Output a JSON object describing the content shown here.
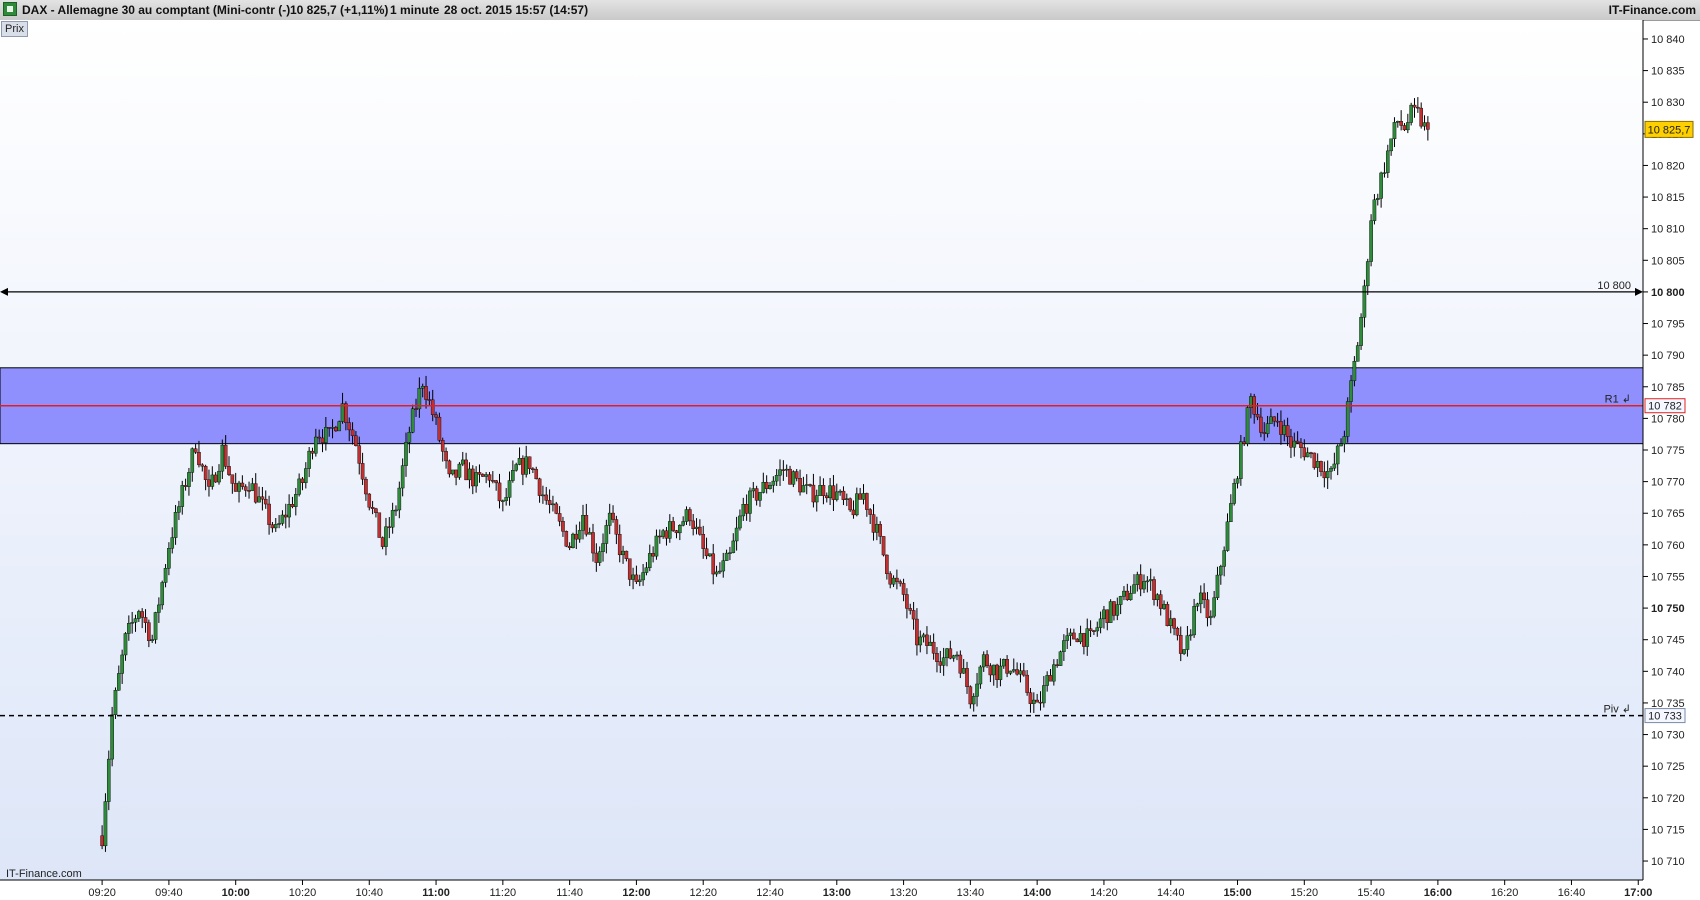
{
  "header": {
    "instrument": "DAX - Allemagne 30 au comptant (Mini-contr (-)",
    "last_change": "10 825,7 (+1,11%)",
    "period": "1 minute",
    "datetime": "28 oct. 2015 15:57 (14:57)",
    "brand": "IT-Finance.com"
  },
  "panel_tab": "Prix",
  "watermark": "IT-Finance.com",
  "chart_data": {
    "type": "line",
    "subtype": "candlestick",
    "ylim": [
      10707,
      10843
    ],
    "y_ticks": [
      {
        "v": 10840,
        "label": "10 840",
        "bold": false
      },
      {
        "v": 10835,
        "label": "10 835",
        "bold": false
      },
      {
        "v": 10830,
        "label": "10 830",
        "bold": false
      },
      {
        "v": 10825,
        "label": "10 825",
        "bold": false
      },
      {
        "v": 10820,
        "label": "10 820",
        "bold": false
      },
      {
        "v": 10815,
        "label": "10 815",
        "bold": false
      },
      {
        "v": 10810,
        "label": "10 810",
        "bold": false
      },
      {
        "v": 10805,
        "label": "10 805",
        "bold": false
      },
      {
        "v": 10800,
        "label": "10 800",
        "bold": true
      },
      {
        "v": 10795,
        "label": "10 795",
        "bold": false
      },
      {
        "v": 10790,
        "label": "10 790",
        "bold": false
      },
      {
        "v": 10785,
        "label": "10 785",
        "bold": false
      },
      {
        "v": 10780,
        "label": "10 780",
        "bold": false
      },
      {
        "v": 10775,
        "label": "10 775",
        "bold": false
      },
      {
        "v": 10770,
        "label": "10 770",
        "bold": false
      },
      {
        "v": 10765,
        "label": "10 765",
        "bold": false
      },
      {
        "v": 10760,
        "label": "10 760",
        "bold": false
      },
      {
        "v": 10755,
        "label": "10 755",
        "bold": false
      },
      {
        "v": 10750,
        "label": "10 750",
        "bold": true
      },
      {
        "v": 10745,
        "label": "10 745",
        "bold": false
      },
      {
        "v": 10740,
        "label": "10 740",
        "bold": false
      },
      {
        "v": 10735,
        "label": "10 735",
        "bold": false
      },
      {
        "v": 10730,
        "label": "10 730",
        "bold": false
      },
      {
        "v": 10725,
        "label": "10 725",
        "bold": false
      },
      {
        "v": 10720,
        "label": "10 720",
        "bold": false
      },
      {
        "v": 10715,
        "label": "10 715",
        "bold": false
      },
      {
        "v": 10710,
        "label": "10 710",
        "bold": false
      }
    ],
    "x_ticks": [
      {
        "t": "09:20",
        "label": "09:20",
        "bold": false
      },
      {
        "t": "09:40",
        "label": "09:40",
        "bold": false
      },
      {
        "t": "10:00",
        "label": "10:00",
        "bold": true
      },
      {
        "t": "10:20",
        "label": "10:20",
        "bold": false
      },
      {
        "t": "10:40",
        "label": "10:40",
        "bold": false
      },
      {
        "t": "11:00",
        "label": "11:00",
        "bold": true
      },
      {
        "t": "11:20",
        "label": "11:20",
        "bold": false
      },
      {
        "t": "11:40",
        "label": "11:40",
        "bold": false
      },
      {
        "t": "12:00",
        "label": "12:00",
        "bold": true
      },
      {
        "t": "12:20",
        "label": "12:20",
        "bold": false
      },
      {
        "t": "12:40",
        "label": "12:40",
        "bold": false
      },
      {
        "t": "13:00",
        "label": "13:00",
        "bold": true
      },
      {
        "t": "13:20",
        "label": "13:20",
        "bold": false
      },
      {
        "t": "13:40",
        "label": "13:40",
        "bold": false
      },
      {
        "t": "14:00",
        "label": "14:00",
        "bold": true
      },
      {
        "t": "14:20",
        "label": "14:20",
        "bold": false
      },
      {
        "t": "14:40",
        "label": "14:40",
        "bold": false
      },
      {
        "t": "15:00",
        "label": "15:00",
        "bold": true
      },
      {
        "t": "15:20",
        "label": "15:20",
        "bold": false
      },
      {
        "t": "15:40",
        "label": "15:40",
        "bold": false
      },
      {
        "t": "16:00",
        "label": "16:00",
        "bold": true
      },
      {
        "t": "16:20",
        "label": "16:20",
        "bold": false
      },
      {
        "t": "16:40",
        "label": "16:40",
        "bold": false
      },
      {
        "t": "17:00",
        "label": "17:00",
        "bold": true
      }
    ],
    "price_path": [
      {
        "t": "09:20",
        "v": 10714
      },
      {
        "t": "09:23",
        "v": 10733
      },
      {
        "t": "09:27",
        "v": 10745
      },
      {
        "t": "09:31",
        "v": 10750
      },
      {
        "t": "09:35",
        "v": 10745
      },
      {
        "t": "09:40",
        "v": 10760
      },
      {
        "t": "09:44",
        "v": 10768
      },
      {
        "t": "09:48",
        "v": 10776
      },
      {
        "t": "09:52",
        "v": 10768
      },
      {
        "t": "09:56",
        "v": 10775
      },
      {
        "t": "10:00",
        "v": 10768
      },
      {
        "t": "10:04",
        "v": 10770
      },
      {
        "t": "10:08",
        "v": 10766
      },
      {
        "t": "10:12",
        "v": 10762
      },
      {
        "t": "10:16",
        "v": 10766
      },
      {
        "t": "10:20",
        "v": 10770
      },
      {
        "t": "10:24",
        "v": 10778
      },
      {
        "t": "10:28",
        "v": 10777
      },
      {
        "t": "10:32",
        "v": 10782
      },
      {
        "t": "10:36",
        "v": 10776
      },
      {
        "t": "10:40",
        "v": 10767
      },
      {
        "t": "10:44",
        "v": 10760
      },
      {
        "t": "10:48",
        "v": 10766
      },
      {
        "t": "10:52",
        "v": 10778
      },
      {
        "t": "10:56",
        "v": 10786
      },
      {
        "t": "11:00",
        "v": 10779
      },
      {
        "t": "11:04",
        "v": 10770
      },
      {
        "t": "11:08",
        "v": 10772
      },
      {
        "t": "11:12",
        "v": 10770
      },
      {
        "t": "11:16",
        "v": 10771
      },
      {
        "t": "11:20",
        "v": 10766
      },
      {
        "t": "11:24",
        "v": 10772
      },
      {
        "t": "11:28",
        "v": 10773
      },
      {
        "t": "11:32",
        "v": 10768
      },
      {
        "t": "11:36",
        "v": 10764
      },
      {
        "t": "11:40",
        "v": 10760
      },
      {
        "t": "11:44",
        "v": 10765
      },
      {
        "t": "11:48",
        "v": 10758
      },
      {
        "t": "11:52",
        "v": 10764
      },
      {
        "t": "11:56",
        "v": 10758
      },
      {
        "t": "12:00",
        "v": 10753
      },
      {
        "t": "12:04",
        "v": 10758
      },
      {
        "t": "12:08",
        "v": 10762
      },
      {
        "t": "12:12",
        "v": 10763
      },
      {
        "t": "12:16",
        "v": 10765
      },
      {
        "t": "12:20",
        "v": 10759
      },
      {
        "t": "12:24",
        "v": 10755
      },
      {
        "t": "12:28",
        "v": 10758
      },
      {
        "t": "12:32",
        "v": 10766
      },
      {
        "t": "12:36",
        "v": 10768
      },
      {
        "t": "12:40",
        "v": 10770
      },
      {
        "t": "12:44",
        "v": 10772
      },
      {
        "t": "12:48",
        "v": 10770
      },
      {
        "t": "12:52",
        "v": 10768
      },
      {
        "t": "12:56",
        "v": 10769
      },
      {
        "t": "13:00",
        "v": 10768
      },
      {
        "t": "13:04",
        "v": 10765
      },
      {
        "t": "13:08",
        "v": 10768
      },
      {
        "t": "13:12",
        "v": 10762
      },
      {
        "t": "13:16",
        "v": 10755
      },
      {
        "t": "13:20",
        "v": 10752
      },
      {
        "t": "13:24",
        "v": 10745
      },
      {
        "t": "13:28",
        "v": 10744
      },
      {
        "t": "13:32",
        "v": 10742
      },
      {
        "t": "13:36",
        "v": 10743
      },
      {
        "t": "13:40",
        "v": 10736
      },
      {
        "t": "13:44",
        "v": 10742
      },
      {
        "t": "13:48",
        "v": 10740
      },
      {
        "t": "13:52",
        "v": 10741
      },
      {
        "t": "13:56",
        "v": 10738
      },
      {
        "t": "14:00",
        "v": 10734
      },
      {
        "t": "14:04",
        "v": 10740
      },
      {
        "t": "14:08",
        "v": 10744
      },
      {
        "t": "14:12",
        "v": 10746
      },
      {
        "t": "14:16",
        "v": 10745
      },
      {
        "t": "14:20",
        "v": 10749
      },
      {
        "t": "14:24",
        "v": 10750
      },
      {
        "t": "14:28",
        "v": 10753
      },
      {
        "t": "14:32",
        "v": 10755
      },
      {
        "t": "14:36",
        "v": 10752
      },
      {
        "t": "14:40",
        "v": 10747
      },
      {
        "t": "14:44",
        "v": 10742
      },
      {
        "t": "14:48",
        "v": 10752
      },
      {
        "t": "14:52",
        "v": 10748
      },
      {
        "t": "14:56",
        "v": 10760
      },
      {
        "t": "15:00",
        "v": 10772
      },
      {
        "t": "15:04",
        "v": 10783
      },
      {
        "t": "15:08",
        "v": 10778
      },
      {
        "t": "15:12",
        "v": 10780
      },
      {
        "t": "15:16",
        "v": 10776
      },
      {
        "t": "15:20",
        "v": 10775
      },
      {
        "t": "15:24",
        "v": 10773
      },
      {
        "t": "15:28",
        "v": 10771
      },
      {
        "t": "15:32",
        "v": 10778
      },
      {
        "t": "15:36",
        "v": 10792
      },
      {
        "t": "15:38",
        "v": 10800
      },
      {
        "t": "15:40",
        "v": 10812
      },
      {
        "t": "15:42",
        "v": 10816
      },
      {
        "t": "15:44",
        "v": 10820
      },
      {
        "t": "15:46",
        "v": 10824
      },
      {
        "t": "15:48",
        "v": 10827
      },
      {
        "t": "15:50",
        "v": 10826
      },
      {
        "t": "15:52",
        "v": 10828
      },
      {
        "t": "15:54",
        "v": 10828
      },
      {
        "t": "15:56",
        "v": 10826
      },
      {
        "t": "15:57",
        "v": 10825.7
      }
    ],
    "resistance_zone": {
      "low": 10776,
      "high": 10788,
      "color": "#8f8ffe"
    },
    "levels": [
      {
        "name": "r1",
        "value": 10782,
        "tag": "R1",
        "label": "10 782",
        "color": "#e02020",
        "style": "solid"
      },
      {
        "name": "pivot",
        "value": 10733,
        "tag": "Piv",
        "label": "10 733",
        "color": "#000000",
        "style": "dashed"
      },
      {
        "name": "horizontal",
        "value": 10800,
        "tag": "10 800",
        "label": "10 800",
        "color": "#000000",
        "style": "arrow"
      }
    ],
    "last_price": {
      "value": 10825.7,
      "label": "10 825,7",
      "color": "#ffd000"
    },
    "colors": {
      "up": "#2e8b3a",
      "down": "#c03030",
      "wick": "#000000",
      "grid": "#000000",
      "bg_top": "#ffffff",
      "bg_bottom": "#dde6f8"
    }
  }
}
